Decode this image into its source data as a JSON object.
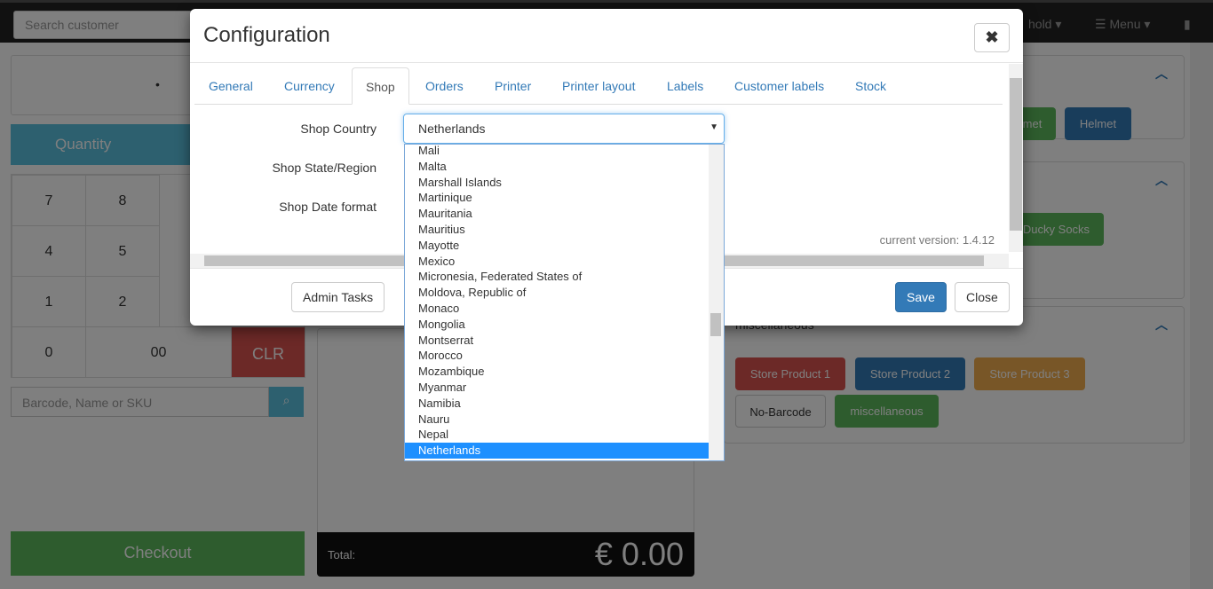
{
  "nav": {
    "search_placeholder": "Search customer",
    "hold": "hold ▾",
    "menu": "Menu ▾"
  },
  "left": {
    "quantity": "Quantity",
    "keys": [
      "7",
      "8",
      "4",
      "5",
      "1",
      "2",
      "0",
      "00",
      "CLR"
    ],
    "barcode_placeholder": "Barcode, Name or SKU",
    "checkout": "Checkout"
  },
  "cart": {
    "total_label": "Total:",
    "total_value": "€ 0.00"
  },
  "categories": {
    "misc_title": "miscellaneous",
    "buttons": [
      "met",
      "Helmet",
      "Ducky Socks",
      "Store Product 1",
      "Store Product 2",
      "Store Product 3",
      "No-Barcode",
      "miscellaneous"
    ]
  },
  "modal": {
    "title": "Configuration",
    "close_x": "✖",
    "tabs": [
      "General",
      "Currency",
      "Shop",
      "Orders",
      "Printer",
      "Printer layout",
      "Labels",
      "Customer labels",
      "Stock"
    ],
    "active_tab": "Shop",
    "fields": {
      "country_label": "Shop Country",
      "state_label": "Shop State/Region",
      "date_label": "Shop Date format",
      "country_value": "Netherlands"
    },
    "version": "current version: 1.4.12",
    "admin_tasks": "Admin Tasks",
    "save": "Save",
    "close": "Close"
  },
  "dropdown": {
    "options": [
      "Mali",
      "Malta",
      "Marshall Islands",
      "Martinique",
      "Mauritania",
      "Mauritius",
      "Mayotte",
      "Mexico",
      "Micronesia, Federated States of",
      "Moldova, Republic of",
      "Monaco",
      "Mongolia",
      "Montserrat",
      "Morocco",
      "Mozambique",
      "Myanmar",
      "Namibia",
      "Nauru",
      "Nepal",
      "Netherlands"
    ],
    "selected": "Netherlands"
  },
  "colors": {
    "primary": "#337ab7",
    "info": "#5bc0de",
    "success": "#5cb85c",
    "danger": "#d9534f",
    "warning": "#f0ad4e",
    "highlight": "#1e90ff"
  }
}
